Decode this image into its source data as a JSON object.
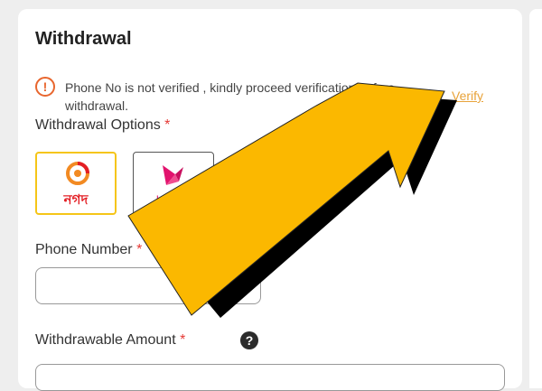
{
  "withdrawal": {
    "title": "Withdrawal",
    "warning": {
      "icon": "exclamation-circle-icon",
      "text": "Phone No is not verified , kindly proceed verification before withdrawal.",
      "link_label": "Verify",
      "color": "#e8662e"
    },
    "options": {
      "label": "Withdrawal Options",
      "required_mark": "*",
      "items": [
        {
          "name": "nagad",
          "text": "নগদ",
          "selected": true
        },
        {
          "name": "bkash",
          "text": "bK"
        }
      ]
    },
    "phone": {
      "label": "Phone Number",
      "required_mark": "*",
      "value": ""
    },
    "amount": {
      "label": "Withdrawable Amount",
      "required_mark": "*",
      "help_icon": "question-circle-icon",
      "help_text": "?"
    }
  },
  "colors": {
    "accent": "#f5c518",
    "link": "#e8a33a",
    "arrow": "#fbb800"
  }
}
